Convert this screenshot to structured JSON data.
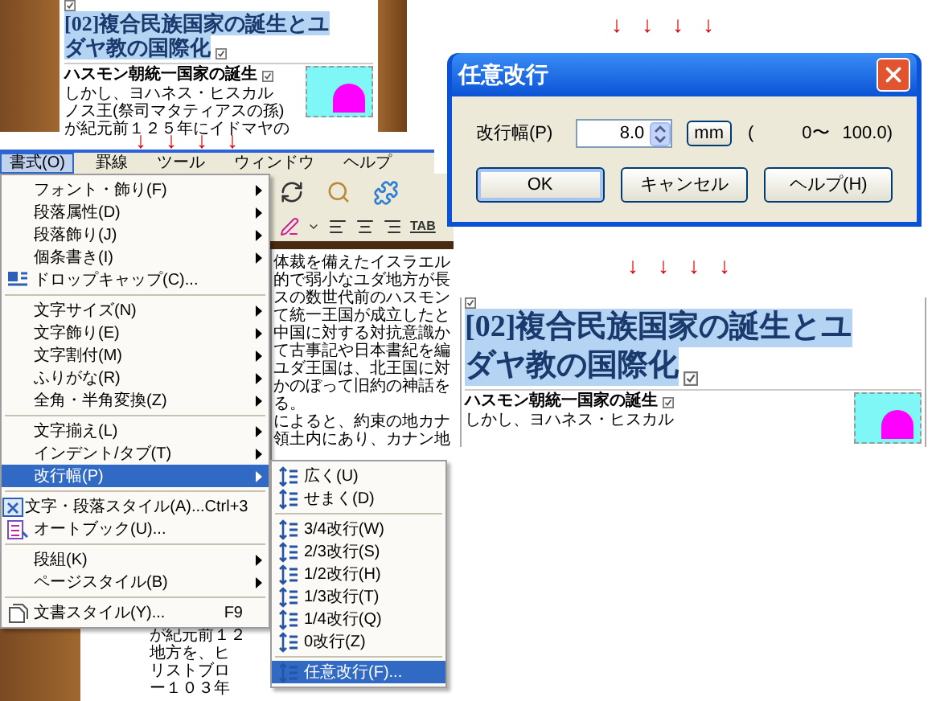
{
  "top_document": {
    "highlighted": true,
    "heading_lines": [
      "[02]複合民族国家の誕生とユ",
      "ダヤ教の国際化"
    ],
    "subheading": "ハスモン朝統一国家の誕生",
    "body_lines": [
      "しかし、ヨハネス・ヒスカル",
      "ノス王(祭司マタティアスの孫)",
      "が紀元前１２５年にイドマヤの"
    ]
  },
  "arrows_left": [
    "↓",
    "↓",
    "↓",
    "↓"
  ],
  "menu_bar": [
    {
      "label": "書式(O)",
      "selected": true
    },
    {
      "label": "罫線",
      "selected": false
    },
    {
      "label": "ツール",
      "selected": false
    },
    {
      "label": "ウィンドウ",
      "selected": false
    },
    {
      "label": "ヘルプ",
      "selected": false
    }
  ],
  "toolbar": {
    "tab_label": "TAB"
  },
  "document_text": {
    "lines": [
      "体裁を備えたイスラエル",
      "的で弱小なユダ地方が長",
      "スの数世代前のハスモン",
      "て統一王国が成立したと",
      "中国に対する対抗意識か",
      "て古事記や日本書紀を編",
      "ユダ王国は、北王国に対",
      "かのぼって旧約の神話を",
      "る。",
      "によると、約束の地カナ",
      "領土内にあり、カナン地"
    ],
    "lower_lines": [
      "が紀元前１２",
      "地方を、ヒ",
      "リストブロ",
      "ー１０３年"
    ]
  },
  "format_menu": [
    {
      "kind": "submenu",
      "label": "フォント・飾り(F)",
      "icon": false,
      "selected": false
    },
    {
      "kind": "submenu",
      "label": "段落属性(D)",
      "icon": false,
      "selected": false
    },
    {
      "kind": "submenu",
      "label": "段落飾り(J)",
      "icon": false,
      "selected": false
    },
    {
      "kind": "submenu",
      "label": "個条書き(I)",
      "icon": false,
      "selected": false
    },
    {
      "kind": "command",
      "label": "ドロップキャップ(C)...",
      "icon": true,
      "selected": false
    },
    {
      "kind": "separator"
    },
    {
      "kind": "submenu",
      "label": "文字サイズ(N)",
      "icon": false,
      "selected": false
    },
    {
      "kind": "submenu",
      "label": "文字飾り(E)",
      "icon": false,
      "selected": false
    },
    {
      "kind": "submenu",
      "label": "文字割付(M)",
      "icon": false,
      "selected": false
    },
    {
      "kind": "submenu",
      "label": "ふりがな(R)",
      "icon": false,
      "selected": false
    },
    {
      "kind": "submenu",
      "label": "全角・半角変換(Z)",
      "icon": false,
      "selected": false
    },
    {
      "kind": "separator"
    },
    {
      "kind": "submenu",
      "label": "文字揃え(L)",
      "icon": false,
      "selected": false
    },
    {
      "kind": "submenu",
      "label": "インデント/タブ(T)",
      "icon": false,
      "selected": false
    },
    {
      "kind": "submenu",
      "label": "改行幅(P)",
      "icon": false,
      "selected": true
    },
    {
      "kind": "separator"
    },
    {
      "kind": "command",
      "label": "文字・段落スタイル(A)...",
      "shortcut": "Ctrl+3",
      "icon": true,
      "selected": false
    },
    {
      "kind": "command",
      "label": "オートブック(U)...",
      "icon": true,
      "selected": false
    },
    {
      "kind": "separator"
    },
    {
      "kind": "submenu",
      "label": "段組(K)",
      "icon": false,
      "selected": false
    },
    {
      "kind": "submenu",
      "label": "ページスタイル(B)",
      "icon": false,
      "selected": false
    },
    {
      "kind": "separator"
    },
    {
      "kind": "command",
      "label": "文書スタイル(Y)...",
      "shortcut": "F9",
      "icon": true,
      "selected": false
    }
  ],
  "line_spacing_submenu": [
    {
      "kind": "command",
      "label": "広く(U)",
      "selected": false
    },
    {
      "kind": "command",
      "label": "せまく(D)",
      "selected": false
    },
    {
      "kind": "separator"
    },
    {
      "kind": "command",
      "label": "3/4改行(W)",
      "selected": false
    },
    {
      "kind": "command",
      "label": "2/3改行(S)",
      "selected": false
    },
    {
      "kind": "command",
      "label": "1/2改行(H)",
      "selected": false
    },
    {
      "kind": "command",
      "label": "1/3改行(T)",
      "selected": false
    },
    {
      "kind": "command",
      "label": "1/4改行(Q)",
      "selected": false
    },
    {
      "kind": "command",
      "label": "0改行(Z)",
      "selected": false
    },
    {
      "kind": "separator"
    },
    {
      "kind": "command",
      "label": "任意改行(F)...",
      "selected": true
    }
  ],
  "arrows_right_top": [
    "↓",
    "↓",
    "↓",
    "↓"
  ],
  "dialog": {
    "title": "任意改行",
    "field_label": "改行幅(P)",
    "value": "8.0",
    "unit": "mm",
    "range_open": "(",
    "range_min": "0〜",
    "range_max": "100.0)",
    "buttons": [
      {
        "label": "OK",
        "default": true
      },
      {
        "label": "キャンセル",
        "default": false
      },
      {
        "label": "ヘルプ(H)",
        "default": false
      }
    ]
  },
  "arrows_right_bottom": [
    "↓",
    "↓",
    "↓",
    "↓"
  ],
  "result_document": {
    "highlighted": true,
    "heading_lines": [
      "[02]複合民族国家の誕生とユ",
      "ダヤ教の国際化"
    ],
    "subheading": "ハスモン朝統一国家の誕生",
    "body_lines": [
      "しかし、ヨハネス・ヒスカル"
    ]
  }
}
